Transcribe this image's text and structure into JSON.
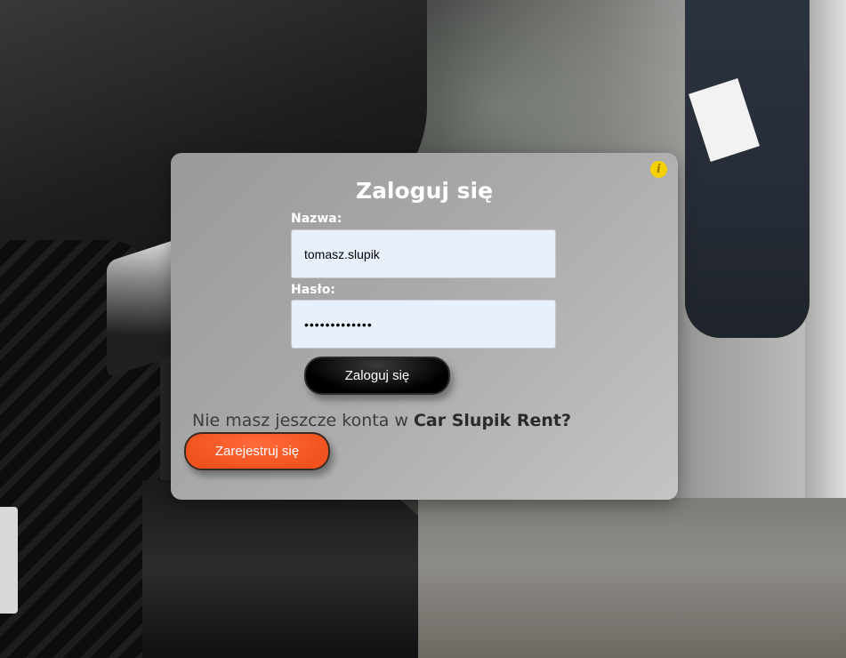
{
  "background": {
    "description_icon": "car-showroom-photo"
  },
  "dialog": {
    "title": "Zaloguj się",
    "info_icon": "i",
    "username": {
      "label": "Nazwa:",
      "value": "tomasz.slupik"
    },
    "password": {
      "label": "Hasło:",
      "value": "•••••••••••••"
    },
    "login_button": "Zaloguj się",
    "register_prompt_prefix": "Nie masz jeszcze konta w ",
    "register_prompt_brand": "Car Slupik Rent?",
    "register_button": "Zarejestruj się"
  },
  "colors": {
    "info_icon": "#f5d000",
    "register_button": "#f0521e",
    "login_button": "#000000",
    "input_background": "#e8f0fe"
  }
}
